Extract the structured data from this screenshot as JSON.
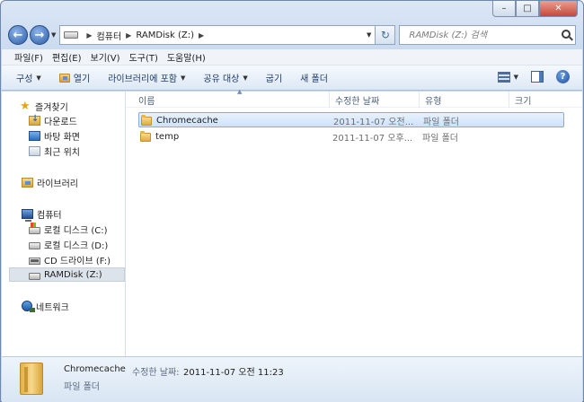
{
  "address": {
    "crumbs": [
      "컴퓨터",
      "RAMDisk (Z:)"
    ],
    "search_placeholder": "RAMDisk (Z:) 검색"
  },
  "menu": [
    "파일(F)",
    "편집(E)",
    "보기(V)",
    "도구(T)",
    "도움말(H)"
  ],
  "commands": {
    "organize": "구성",
    "open": "열기",
    "include_library": "라이브러리에 포함",
    "share_with": "공유 대상",
    "burn": "굽기",
    "new_folder": "새 폴더"
  },
  "nav": {
    "favorites": "즐겨찾기",
    "downloads": "다운로드",
    "desktop": "바탕 화면",
    "recent": "최근 위치",
    "libraries": "라이브러리",
    "computer": "컴퓨터",
    "drive_c": "로컬 디스크 (C:)",
    "drive_d": "로컬 디스크 (D:)",
    "drive_f": "CD 드라이브 (F:)",
    "drive_z": "RAMDisk (Z:)",
    "network": "네트워크"
  },
  "columns": {
    "name": "이름",
    "modified": "수정한 날짜",
    "type": "유형",
    "size": "크기"
  },
  "files": [
    {
      "name": "Chromecache",
      "modified": "2011-11-07 오전...",
      "type": "파일 폴더",
      "size": ""
    },
    {
      "name": "temp",
      "modified": "2011-11-07 오후...",
      "type": "파일 폴더",
      "size": ""
    }
  ],
  "details": {
    "name": "Chromecache",
    "modified_label": "수정한 날짜:",
    "modified_value": "2011-11-07 오전 11:23",
    "type": "파일 폴더"
  }
}
